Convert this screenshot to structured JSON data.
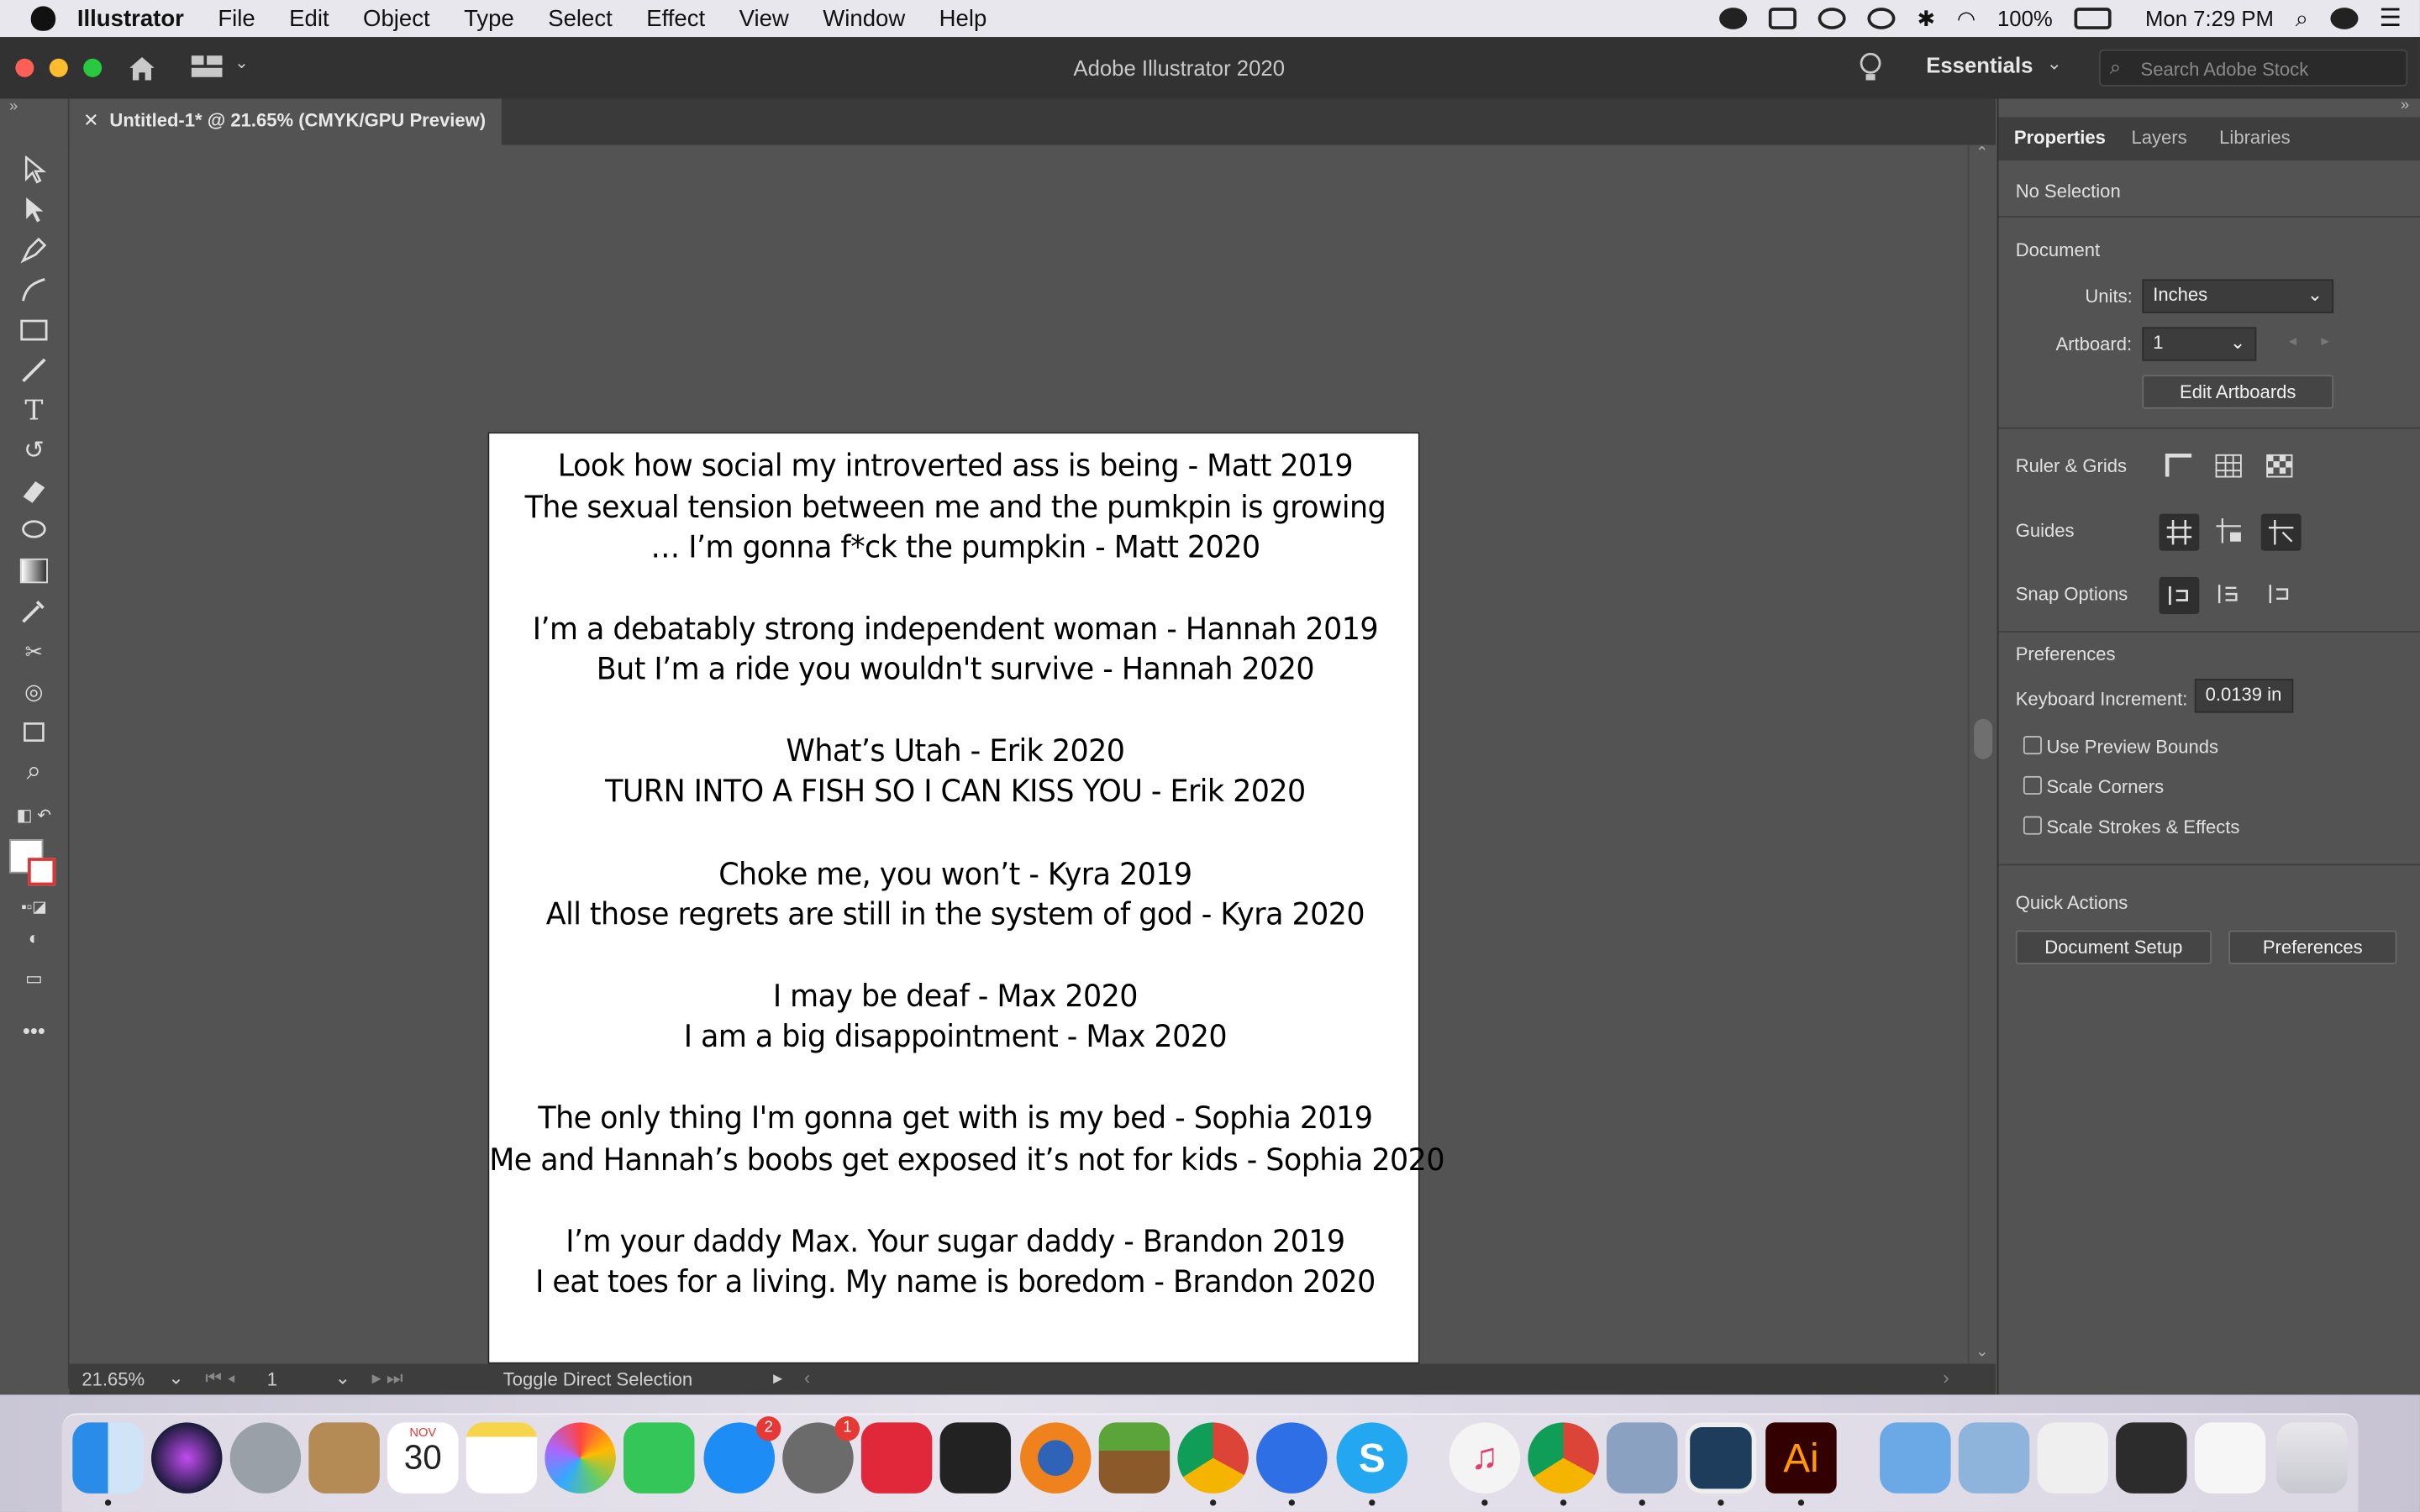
{
  "menubar": {
    "app": "Illustrator",
    "items": [
      "File",
      "Edit",
      "Object",
      "Type",
      "Select",
      "Effect",
      "View",
      "Window",
      "Help"
    ],
    "battery": "100%",
    "clock": "Mon 7:29 PM"
  },
  "appbar": {
    "title": "Adobe Illustrator 2020",
    "workspace": "Essentials",
    "search_placeholder": "Search Adobe Stock"
  },
  "document": {
    "tab_title": "Untitled-1* @ 21.65% (CMYK/GPU Preview)"
  },
  "artboard": {
    "lines": [
      "Look how social my introverted ass is being - Matt 2019",
      "The sexual tension between me and the pumkpin is growing",
      "… I’m gonna f*ck the pumpkin - Matt 2020",
      "I’m a debatably strong independent woman - Hannah 2019",
      "But I’m a ride you wouldn't survive - Hannah 2020",
      "What’s Utah - Erik 2020",
      "TURN INTO A FISH SO I CAN KISS YOU - Erik 2020",
      "Choke me, you won’t - Kyra 2019",
      "All those regrets are still in the system of god - Kyra 2020",
      "I may be deaf - Max 2020",
      "I am a big disappointment - Max 2020",
      "The only thing I'm gonna get with is my bed - Sophia 2019",
      "Me and Hannah’s boobs get exposed it’s not for kids - Sophia 2020",
      "I’m your daddy Max. Your sugar daddy - Brandon 2019",
      "I eat toes for a living. My name is boredom - Brandon 2020"
    ]
  },
  "status": {
    "zoom": "21.65%",
    "artboard_num": "1",
    "tool_hint": "Toggle Direct Selection"
  },
  "panel": {
    "tabs": [
      "Properties",
      "Layers",
      "Libraries"
    ],
    "no_selection": "No Selection",
    "document_label": "Document",
    "units_label": "Units:",
    "units_value": "Inches",
    "artboard_label": "Artboard:",
    "artboard_value": "1",
    "edit_artboards": "Edit Artboards",
    "ruler_grids": "Ruler & Grids",
    "guides": "Guides",
    "snap_options": "Snap Options",
    "preferences_label": "Preferences",
    "keyboard_increment_label": "Keyboard Increment:",
    "keyboard_increment_value": "0.0139 in",
    "use_preview_bounds": "Use Preview Bounds",
    "scale_corners": "Scale Corners",
    "scale_strokes": "Scale Strokes & Effects",
    "quick_actions": "Quick Actions",
    "document_setup": "Document Setup",
    "preferences_btn": "Preferences"
  },
  "dock": {
    "calendar_month": "NOV",
    "calendar_day": "30",
    "appstore_badge": "2",
    "settings_badge": "1",
    "ai_label": "Ai",
    "skype_label": "S"
  },
  "colors": {
    "accent": "#31a8ff",
    "panel_bg": "#535353",
    "appbar_bg": "#323232",
    "ai_bg": "#330000",
    "ai_fg": "#ff9a00"
  }
}
